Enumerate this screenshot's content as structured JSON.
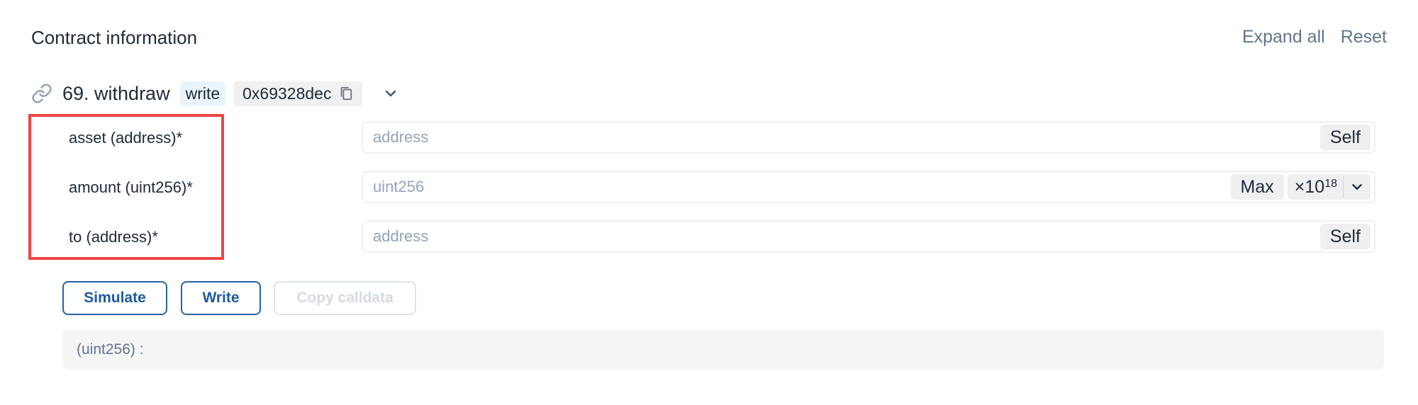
{
  "header": {
    "title": "Contract information",
    "expand_all": "Expand all",
    "reset": "Reset"
  },
  "method": {
    "index_name": "69. withdraw",
    "type_badge": "write",
    "selector": "0x69328dec"
  },
  "params": [
    {
      "label": "asset (address)*",
      "placeholder": "address",
      "action": "Self"
    },
    {
      "label": "amount (uint256)*",
      "placeholder": "uint256",
      "action": "Max",
      "unit_base": "×10",
      "unit_exp": "18"
    },
    {
      "label": "to (address)*",
      "placeholder": "address",
      "action": "Self"
    }
  ],
  "buttons": {
    "simulate": "Simulate",
    "write": "Write",
    "copy_calldata": "Copy calldata"
  },
  "result": {
    "text": "(uint256) :"
  },
  "colors": {
    "accent": "#1f5aa0",
    "highlight": "#ef4444"
  }
}
